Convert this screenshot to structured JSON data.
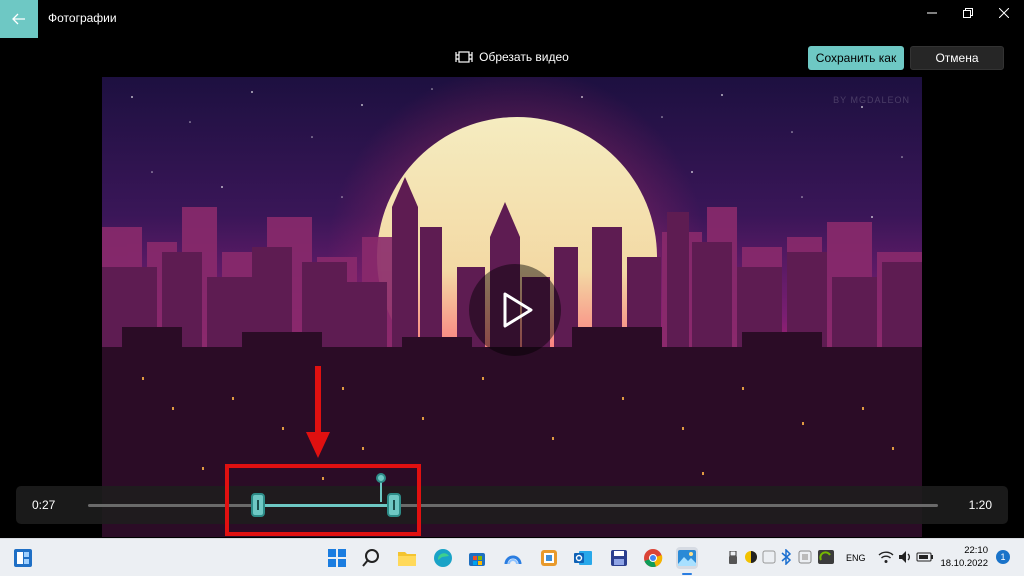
{
  "window": {
    "app_title": "Фотографии"
  },
  "toolbar": {
    "trim_title": "Обрезать видео",
    "save_label": "Сохранить как",
    "cancel_label": "Отмена"
  },
  "video": {
    "watermark": "BY MGDALEON"
  },
  "timeline": {
    "start_time": "0:27",
    "end_time": "1:20",
    "trim_start_fraction": 0.2,
    "trim_end_fraction": 0.36,
    "playhead_fraction": 0.345
  },
  "taskbar": {
    "icons": [
      "widgets-icon",
      "start-icon",
      "search-icon",
      "file-explorer-icon",
      "edge-icon",
      "store-icon",
      "cloud-app-icon",
      "security-app-icon",
      "outlook-icon",
      "save-app-icon",
      "chrome-icon",
      "photos-icon"
    ],
    "language": "ENG",
    "time": "22:10",
    "date": "18.10.2022",
    "notification_count": "1"
  },
  "colors": {
    "accent": "#6ec8c4",
    "annotation": "#e01010"
  }
}
